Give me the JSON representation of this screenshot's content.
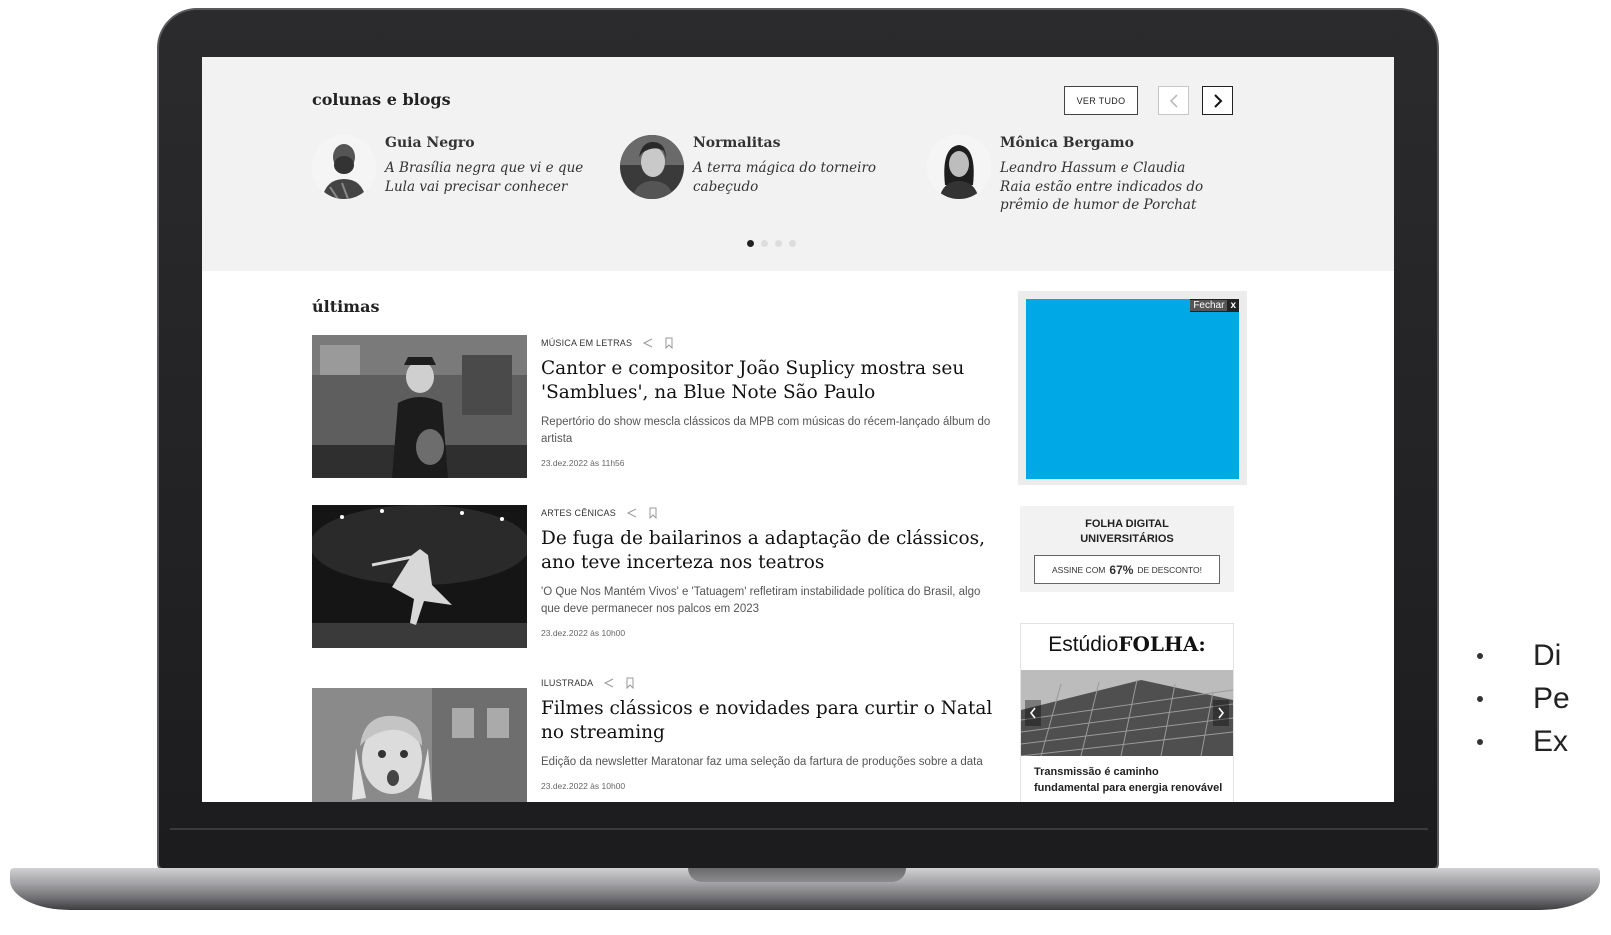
{
  "columns": {
    "title": "colunas e blogs",
    "view_all_label": "VER TUDO",
    "items": [
      {
        "author": "Guia Negro",
        "headline": "A Brasília negra que vi e que Lula vai precisar conhecer"
      },
      {
        "author": "Normalitas",
        "headline": "A terra mágica do torneiro cabeçudo"
      },
      {
        "author": "Mônica Bergamo",
        "headline": "Leandro Hassum e Claudia Raia estão entre indicados do prêmio de humor de Porchat"
      }
    ],
    "carousel_pages": 4,
    "carousel_active_index": 0
  },
  "latest": {
    "title": "últimas",
    "articles": [
      {
        "section": "MÚSICA EM LETRAS",
        "title": "Cantor e compositor João Suplicy mostra seu 'Samblues', na Blue Note São Paulo",
        "summary": "Repertório do show mescla clássicos da MPB com músicas do récem-lançado álbum do artista",
        "time": "23.dez.2022 às 11h56"
      },
      {
        "section": "ARTES CÊNICAS",
        "title": "De fuga de bailarinos a adaptação de clássicos, ano teve incerteza nos teatros",
        "summary": "'O Que Nos Mantém Vivos' e 'Tatuagem' refletiram instabilidade política do Brasil, algo que deve permanecer nos palcos em 2023",
        "time": "23.dez.2022 às 10h00"
      },
      {
        "section": "ILUSTRADA",
        "title": "Filmes clássicos e novidades para curtir o Natal no streaming",
        "summary": "Edição da newsletter Maratonar faz uma seleção da fartura de produções sobre a data",
        "time": "23.dez.2022 às 10h00"
      }
    ]
  },
  "ad": {
    "close_label": "Fechar",
    "close_x": "x",
    "color": "#00a9e6"
  },
  "promo": {
    "title_line1": "FOLHA DIGITAL",
    "title_line2": "UNIVERSITÁRIOS",
    "button_prefix": "ASSINE COM",
    "button_pct": "67%",
    "button_suffix": "DE DESCONTO!"
  },
  "studio": {
    "logo_prefix": "Estúdio",
    "logo_brand": "FOLHA",
    "logo_suffix": ":",
    "caption": "Transmissão é caminho fundamental para energia renovável"
  },
  "side_bullets": [
    "Di",
    "Pe",
    "Ex"
  ]
}
